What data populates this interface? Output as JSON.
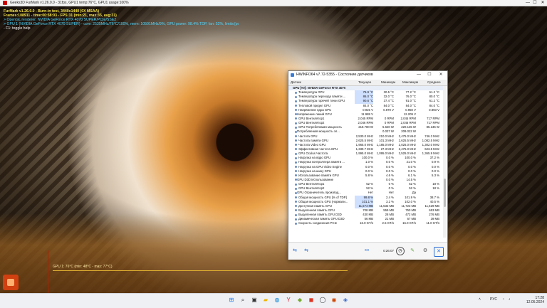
{
  "app_bar": {
    "title": "Geeks3D FurMark v1.26.0.0 - 31fps, GPU1 temp:76°C, GPU1 usage:100%",
    "minimize": "—",
    "maximize": "☐",
    "close": "✕"
  },
  "overlay": {
    "line1": "FurMark v1.26.0.0 - Burn-in test, 3440x1440 (0X MSAA)",
    "line2": "Frames:108911 - time:00:58:03 - FPS:31 (min:21, max:35, avg:31)",
    "line3": "> OpenGL renderer: NVIDIA GeForce RTX 4070 SUPER/PCIe/SSE2",
    "line4": "> GPU 1 (NVIDIA GeForce RTX 4070 SUPER) - core: 2535MHz/76°C/100%, mem: 10501MHz/9%, GPU power: 98.4% TDP, fan: 52%, limits:[power:1, temp:0, volt:0, OV:0]",
    "line5": "- F1: toggle help",
    "graph_label": "GPU 1: 76°C (min: 48°C - max: 77°C)"
  },
  "hwinfo": {
    "title": "HWiNFO64 v7.72-5355 - Состояние датчиков",
    "min": "—",
    "max": "☐",
    "close": "✕",
    "headers": {
      "name": "Датчик",
      "cur": "Текущее",
      "min": "Минимум",
      "max": "Максимум",
      "avg": "Среднее"
    },
    "rows": [
      {
        "name": "GPU [#0]: NVIDIA GeForce RTX 4070 SUPER:",
        "cur": "",
        "min": "",
        "max": "",
        "avg": "",
        "group": true
      },
      {
        "name": "Температура GPU",
        "cur": "76.9 °C",
        "min": "30.5 °C",
        "max": "77.2 °C",
        "avg": "61.2 °C",
        "hl": true
      },
      {
        "name": "Температура перехода памяти ...",
        "cur": "86.0 °C",
        "min": "32.0 °C",
        "max": "76.0 °C",
        "avg": "80.0 °C",
        "hl": true
      },
      {
        "name": "Температура горячей точки GPU",
        "cur": "90.6 °C",
        "min": "37.4 °C",
        "max": "91.0 °C",
        "avg": "61.2 °C",
        "hl": true
      },
      {
        "name": "Тепловой предел GPU",
        "cur": "84.0 °C",
        "min": "84.0 °C",
        "max": "84.0 °C",
        "avg": "84.0 °C"
      },
      {
        "name": "Напряжение ядра GPU",
        "cur": "0.925 V",
        "min": "0.870 V",
        "max": "0.950 V",
        "avg": "0.893 V"
      },
      {
        "name": "Напряжение линий GPU",
        "cur": "11.988 V",
        "min": "",
        "max": "12.209 V",
        "avg": "",
        "sub": true
      },
      {
        "name": "GPU Вентилятор1",
        "cur": "2,045 RPM",
        "min": "0 RPM",
        "max": "2,045 RPM",
        "avg": "717 RPM"
      },
      {
        "name": "GPU Вентилятор2",
        "cur": "2,046 RPM",
        "min": "0 RPM",
        "max": "2,046 RPM",
        "avg": "717 RPM"
      },
      {
        "name": "GPU Потребляемая мощность",
        "cur": "218.780 W",
        "min": "5.620 W",
        "max": "220.135 W",
        "avg": "85.136 W"
      },
      {
        "name": "Потребляемая мощность эл...",
        "cur": "",
        "min": "0.037 W",
        "max": "209.022 W",
        "avg": "",
        "sub": true
      },
      {
        "name": "Частота GPU",
        "cur": "2,530.0 MHz",
        "min": "210.0 MHz",
        "max": "2,475.0 MHz",
        "avg": "746.3 MHz"
      },
      {
        "name": "Частота памяти GPU",
        "cur": "2,625.5 MHz",
        "min": "101.3 MHz",
        "max": "2,625.5 MHz",
        "avg": "1,082.5 MHz"
      },
      {
        "name": "Частота Video GPU",
        "cur": "1,965.0 MHz",
        "min": "1,185.0 MHz",
        "max": "2,025.0 MHz",
        "avg": "1,302.0 MHz"
      },
      {
        "name": "Эффективная частота GPU",
        "cur": "1,339.7 MHz",
        "min": "27.3 MHz",
        "max": "2,475.0 MHz",
        "avg": "623.5 MHz"
      },
      {
        "name": "GPU Oculus Частота",
        "cur": "1,995.0 MHz",
        "min": "1,095.0 MHz",
        "max": "2,525.0 MHz",
        "avg": "1,365.9 MHz"
      },
      {
        "name": "Нагрузка на ядро GPU",
        "cur": "100.0 %",
        "min": "0.0 %",
        "max": "100.0 %",
        "avg": "37.2 %"
      },
      {
        "name": "Нагрузка контроллера памяти ...",
        "cur": "1.0 %",
        "min": "0.0 %",
        "max": "21.0 %",
        "avg": "0.9 %"
      },
      {
        "name": "Нагрузка на GPU Video Engine",
        "cur": "0.0 %",
        "min": "0.0 %",
        "max": "0.0 %",
        "avg": "0.0 %"
      },
      {
        "name": "Нагрузка на шину GPU",
        "cur": "0.0 %",
        "min": "0.0 %",
        "max": "0.0 %",
        "avg": "0.0 %"
      },
      {
        "name": "Использование памяти GPU",
        "cur": "5.8 %",
        "min": "4.6 %",
        "max": "6.1 %",
        "avg": "5.3 %"
      },
      {
        "name": "GPU D3D Использование",
        "cur": "",
        "min": "0.0 %",
        "max": "14.5 %",
        "avg": "",
        "sub": true
      },
      {
        "name": "GPU Вентилятор1",
        "cur": "52 %",
        "min": "0 %",
        "max": "52 %",
        "avg": "18 %"
      },
      {
        "name": "GPU Вентилятор2",
        "cur": "52 %",
        "min": "0 %",
        "max": "52 %",
        "avg": "18 %"
      },
      {
        "name": "GPU Ограничитель производ...",
        "cur": "Нет",
        "min": "Нет",
        "max": "Да",
        "avg": "",
        "sub": true
      },
      {
        "name": "Общая мощность GPU [% of TDP]",
        "cur": "99.8 %",
        "min": "2.4 %",
        "max": "101.9 %",
        "avg": "38.7 %",
        "hl": true
      },
      {
        "name": "Общая мощность GPU (нормали...",
        "cur": "101.1 %",
        "min": "3.2 %",
        "max": "102.0 %",
        "avg": "40.5 %",
        "hl": true
      },
      {
        "name": "Доступная память GPU",
        "cur": "11,574 MB",
        "min": "11,532 MB",
        "max": "11,723 MB",
        "avg": "11,629 MB",
        "hl": true
      },
      {
        "name": "Выделенная память GPU",
        "cur": "708 MB",
        "min": "559 MB",
        "max": "750 MB",
        "avg": "653 MB"
      },
      {
        "name": "Выделенная память GPU D3D",
        "cur": "430 MB",
        "min": "28 MB",
        "max": "472 MB",
        "avg": "276 MB"
      },
      {
        "name": "Динамическая память GPU D3D",
        "cur": "56 MB",
        "min": "21 MB",
        "max": "67 MB",
        "avg": "39 MB"
      },
      {
        "name": "Скорость соединения PCIe",
        "cur": "16.0 GT/s",
        "min": "2.5 GT/s",
        "max": "16.0 GT/s",
        "avg": "11.0 GT/s"
      }
    ],
    "clock": "0:26:07"
  },
  "taskbar": {
    "lang": "РУС",
    "time": "17:28",
    "date": "12.05.2024"
  }
}
